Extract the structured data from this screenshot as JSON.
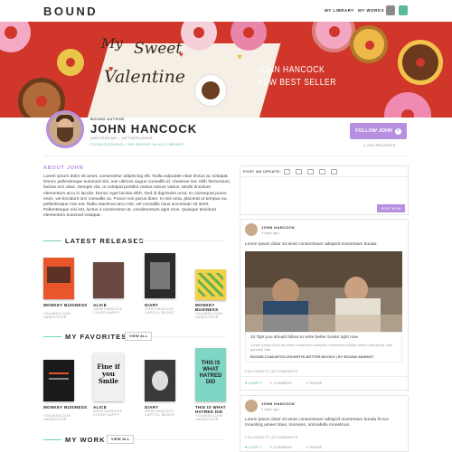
{
  "header": {
    "logo": "BOUND",
    "nav": [
      "MY LIBRARY",
      "MY WORKS"
    ],
    "icons": [
      "book-stack-icon",
      "bookmark-icon"
    ]
  },
  "hero": {
    "script_line1": "My",
    "script_line2": "Sweet",
    "script_line3": "Valentine",
    "headline_line1": "JOHN HANCOCK",
    "headline_line2": "NEW BEST SELLER",
    "colors": {
      "background": "#d0362a",
      "card": "#f6efe6"
    }
  },
  "profile": {
    "role": "BOUND AUTHOR",
    "name": "JOHN HANCOCK",
    "location": "AMSTERDAM – NETHERLANDS",
    "stats": "FOOD/COOKING • 393 BOOKS IN HIS LIBRARY",
    "follow_label": "FOLLOW JOHN",
    "readers": "1,256 READERS"
  },
  "about": {
    "title": "ABOUT JOHN",
    "text": "Lorem ipsum dolor sit amet, consectetur adipiscing elit. Nulla vulputate vitae lectus ac volutpat. Donec pellentesque euismod nisl, non ultrices augue convallis id. Vivamus nec nibh fermentum, lacinia orci vitae. Semper dui. In volutpat porttitor metus rutrum varius. Morbi tincidunt elementum arcu in iaculis. Donec eget lacinia nibh. Sed id dignissim urna. In consequat purus enim, vel tincidunt orci convallis ac. Fusce non purus diam. In nisl urna, placerat ut tempus eu, pellentesque non est. Nulla maximus arcu nisl, vel convallis risus accumsan sit amet. Pellentesque nisi est, luctus a consectetur at, condimentum eget eros. Quisque tincidunt elementum euismod volutpat."
  },
  "releases": {
    "title": "LATEST RELEASES",
    "books": [
      {
        "title": "MONKEY BUSINESS",
        "author": "YOLANDA CAIN",
        "format": "HARDCOVER",
        "color": "#e8562a"
      },
      {
        "title": "ALICE",
        "author": "JOHN HANCOCK",
        "format": "COVER NAPPY",
        "color": "#6a4a40"
      },
      {
        "title": "DIARY",
        "author": "JOHN HANCOCK",
        "format": "CAPITOL BOOKS",
        "color": "#2a2a2a"
      },
      {
        "title": "MONKEY BUSINESS",
        "author": "YOLANDA CAIN",
        "format": "HARDCOVER",
        "color": "#f2d24a"
      }
    ]
  },
  "favorites": {
    "title": "MY FAVORITES",
    "view_all": "VIEW ALL",
    "books": [
      {
        "title": "MONKEY BUSINESS",
        "author": "YOLANDA CAIN",
        "format": "HARDCOVER",
        "color": "#1a1a1a"
      },
      {
        "title": "ALICE",
        "author": "JOHN HANCOCK",
        "format": "COVER NAPPY",
        "color": "#f0f0f0"
      },
      {
        "title": "DIARY",
        "author": "JOHN HANCOCK",
        "format": "CAPITOL BOOKS",
        "color": "#3a3a3a"
      },
      {
        "title": "THIS IS WHAT HATRED DID",
        "author": "YOLANDA CAIN",
        "format": "HARDCOVER",
        "color": "#7fd6c4"
      }
    ],
    "cover_text_1": "Fine if you Smile",
    "cover_text_2": "THIS IS WHAT HATRED DID"
  },
  "work": {
    "title": "MY WORK",
    "view_all": "VIEW ALL"
  },
  "post_box": {
    "label": "POST AN UPDATE:",
    "post_button": "POST NOW"
  },
  "feed": [
    {
      "author": "JOHN HANCOCK",
      "time": "3 days ago",
      "text": "Lorem ipsum dolor sit amet consectetuer adispicil momentum bunda.",
      "link_title": "10 Tips  you should follow to write better books right now",
      "link_desc": "Lorem ipsum dolor sit amet consectuer adispicil momentum bunda onfine sed alpha. fuia. gamma. inta.",
      "link_url": "BOUND.COM/ARTICLES/WRITE-BETTER-BOOKS | BY BOUND-MARKET",
      "stats": "1.26 LOVED IT   |   32 COMMENTS",
      "actions": [
        "LOVE IT",
        "COMMENT",
        "SHARE"
      ]
    },
    {
      "author": "JOHN HANCOCK",
      "time": "3 days ago",
      "text": "Lorem ipsum dolor sit amet consectetuer adispicil momentum bunda fit sce mounting ameet lotus, momeno, somodello moneticus.",
      "stats": "1.26 LOVED IT   |   32 COMMENTS",
      "actions": [
        "LOVE IT",
        "COMMENT",
        "SHARE"
      ]
    }
  ]
}
